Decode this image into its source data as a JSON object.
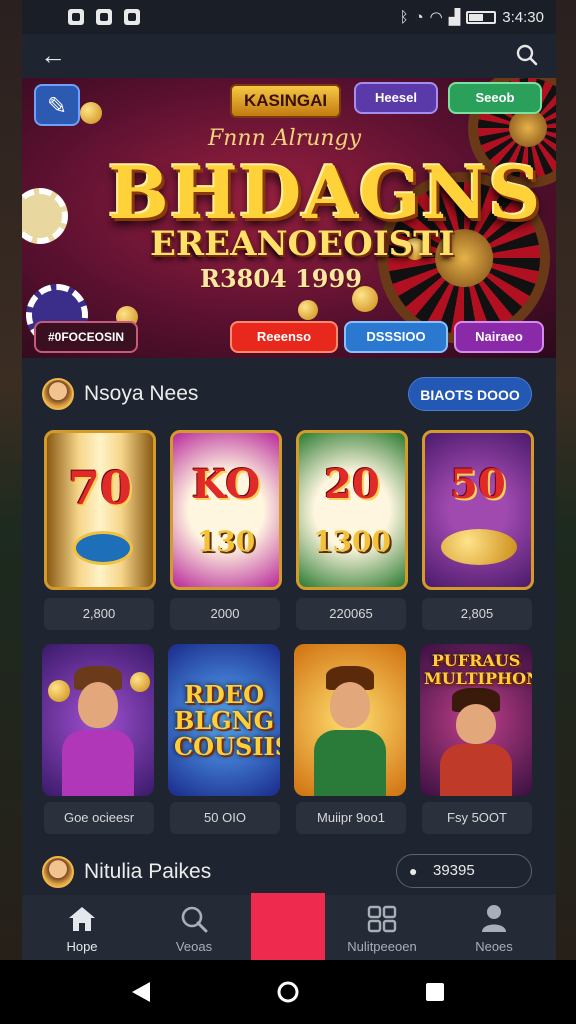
{
  "status_bar": {
    "time": "3:4:30"
  },
  "banner": {
    "tag": "KASINGAI",
    "script": "Fnnn Alrungy",
    "title": "BHDAGNS",
    "subtitle": "EREANOEOISTI",
    "number": "R3804 1999",
    "pill_top_1": "Heesel",
    "pill_top_2": "Seeob",
    "pill_bottom_left": "#0FOCEOSIN",
    "pill_red": "Reeenso",
    "pill_blue": "DSSSIOO",
    "pill_purple": "Nairaeo"
  },
  "section1": {
    "title": "Nsoya Nees",
    "button": "BIAOTS DOOO",
    "tiles": [
      {
        "top": "70",
        "bottom": "",
        "price": "2,800"
      },
      {
        "top": "KO",
        "bottom": "130",
        "price": "2000"
      },
      {
        "top": "20",
        "bottom": "1300",
        "price": "220065"
      },
      {
        "top": "50",
        "bottom": "",
        "price": "2,805"
      }
    ],
    "chars": [
      {
        "text": "",
        "price": "Goe ocieesr"
      },
      {
        "text": "RDEO BLGNG COUSIIS",
        "price": "50 OIO"
      },
      {
        "text": "",
        "price": "Muiipr 9oo1"
      },
      {
        "text": "PUFRAUS MULTIPHON",
        "price": "Fsy 5OOT"
      }
    ]
  },
  "section2": {
    "title": "Nitulia Paikes",
    "likes": "39395"
  },
  "bottom_nav": [
    {
      "label": "Hope",
      "icon": "home-icon"
    },
    {
      "label": "Veoas",
      "icon": "search-icon"
    },
    {
      "label": "",
      "icon": "featured"
    },
    {
      "label": "Nulitpeeoen",
      "icon": "grid-icon"
    },
    {
      "label": "Neoes",
      "icon": "profile-icon"
    }
  ]
}
